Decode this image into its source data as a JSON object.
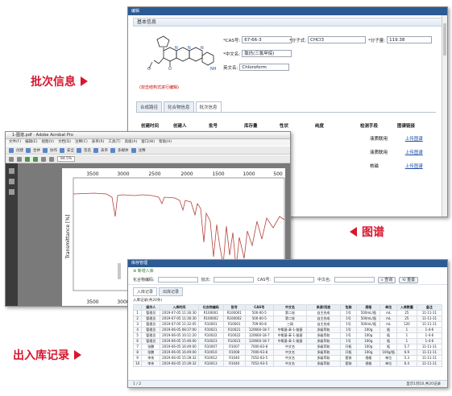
{
  "callouts": {
    "batch": "批次信息",
    "spectrum": "图谱",
    "stock": "出入库记录"
  },
  "winA": {
    "title": "编辑",
    "section": "基本信息",
    "cas_label": "*CAS号:",
    "cas_value": "67-66-3",
    "formula_label": "*分子式:",
    "formula_value": "CHCl3",
    "mw_label": "*分子量:",
    "mw_value": "119.38",
    "cn_label": "*中文名:",
    "cn_value": "氯仿(三氯甲烷)",
    "en_label": "英文名:",
    "en_value": "Chloroform",
    "edit_link": "(双击结构式进行编辑)",
    "tabs": [
      "合成路径",
      "化合物信息",
      "批次信息"
    ],
    "columns": [
      "创建时间",
      "创建人",
      "批号",
      "库存量",
      "性状",
      "纯度",
      "检测手段",
      "图谱链接"
    ],
    "rows": [
      {
        "method": "液质联用",
        "link": "上传图谱"
      },
      {
        "method": "液质联用",
        "link": "上传图谱"
      },
      {
        "method": "核磁",
        "link": "上传图谱"
      }
    ],
    "colors": {
      "title_bar": "#2c5a93",
      "link": "#1d4fa8",
      "edit_link": "#c00000"
    }
  },
  "winB": {
    "title": "1-图谱.pdf - Adobe Acrobat Pro",
    "menu": [
      "文件(F)",
      "编辑(E)",
      "视图(V)",
      "文档(D)",
      "注释(C)",
      "表单(R)",
      "工具(T)",
      "高级(A)",
      "窗口(W)",
      "帮助(H)"
    ],
    "toolbar": [
      "创建",
      "合并",
      "协作",
      "安全",
      "签名",
      "表单",
      "多媒体",
      "注释"
    ],
    "zoom": "84.5%",
    "y_axis_label": "Transmittance [%]",
    "x_ticks_top": [
      "3500",
      "3000",
      "2500",
      "2000",
      "1500",
      "1000",
      "500"
    ],
    "x_ticks_bottom": [
      "3500",
      "3000"
    ]
  },
  "winC": {
    "title": "库存管理",
    "action": "新增入库",
    "filters": [
      {
        "label": "化合物编码:"
      },
      {
        "label": "批次:"
      },
      {
        "label": "CAS号:"
      },
      {
        "label": "中文名:"
      }
    ],
    "btn_search": "查询",
    "btn_reset": "重置",
    "tabs": [
      "入库记录",
      "出库记录"
    ],
    "caption": "入库记录(共20条)",
    "columns": [
      "",
      "操作人",
      "入库时间",
      "化合物编码",
      "批号",
      "CAS号",
      "中文名",
      "来源/用途",
      "包装",
      "规格",
      "单位",
      "入库数量",
      "备注"
    ],
    "rows": [
      [
        "1",
        "管理员",
        "2019-07-05 11:30:30",
        "R100001",
        "R100001",
        "500-00-5",
        "第二轮",
        "自主合成",
        "1号",
        "500mL/瓶",
        "mL",
        "25",
        "11-11-11"
      ],
      [
        "2",
        "管理员",
        "2019-07-05 11:30:30",
        "R100002",
        "R100002",
        "500-00-5",
        "第二轮",
        "自主合成",
        "1号",
        "500mL/瓶",
        "mL",
        "25",
        "11-11-11"
      ],
      [
        "3",
        "管理员",
        "2019-07-05 11:32:05",
        "R10001",
        "R10001",
        "709-00-8",
        "三硝",
        "自主合成",
        "1号",
        "500mL/瓶",
        "mL",
        "120",
        "11-11-11"
      ],
      [
        "4",
        "管理员",
        "2019-06-05 08:37:00",
        "R10021",
        "R10021",
        "120660-18-7",
        "中氧基-苯-1-羧基",
        "多级萃取",
        "1号",
        "100g",
        "瓶",
        "1",
        "1-4-6"
      ],
      [
        "5",
        "管理员",
        "2019-06-05 10:11:20",
        "R10022",
        "R10022",
        "120660-18-7",
        "中氧基-苯-1-羧基",
        "多级萃取",
        "1号",
        "100g",
        "瓶",
        "1",
        "1-4-6"
      ],
      [
        "6",
        "管理员",
        "2019-06-05 15:46:00",
        "R10023",
        "R10023",
        "120660-18-7",
        "中氧基-苯-1-羧基",
        "多级萃取",
        "1号",
        "100g",
        "瓶",
        "1",
        "1-4-6"
      ],
      [
        "7",
        "张鹏",
        "2019-06-05 16:49:00",
        "R10007",
        "R1007",
        "7000-83-8",
        "中文名",
        "多级萃取",
        "开瓶",
        "100g",
        "瓶",
        "5.7",
        "11-11-11"
      ],
      [
        "8",
        "张鹏",
        "2019-06-05 16:49:00",
        "R10010",
        "R1008",
        "7000-93-8",
        "中文名",
        "多级萃取",
        "开瓶",
        "100g",
        "100g/瓶",
        "6.9",
        "11-11-11"
      ],
      [
        "9",
        "李伟",
        "2019-06-05 15:39:32",
        "R10012",
        "R1040",
        "7052-83-5",
        "中文名",
        "多级萃取",
        "套装",
        "规格",
        "单位",
        "5.3",
        "11-11-11"
      ],
      [
        "10",
        "李伟",
        "2019-06-05 15:39:32",
        "R10013",
        "R1040",
        "7052-93-5",
        "中文名",
        "多级萃取",
        "套装",
        "规格",
        "单位",
        "6.4",
        "11-11-11"
      ]
    ],
    "footer_left": "1 / 2",
    "footer_right": "显示1到10,共20记录"
  }
}
